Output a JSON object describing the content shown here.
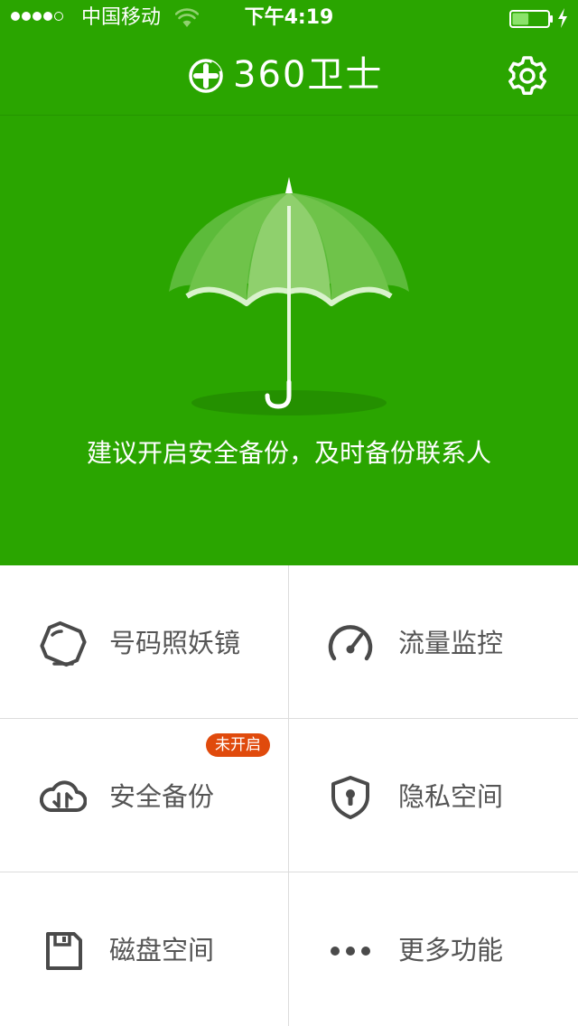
{
  "status_bar": {
    "carrier": "中国移动",
    "time": "下午4:19",
    "signal_strength": 4,
    "signal_total": 5,
    "battery_level": 0.45,
    "charging": true,
    "wifi": true
  },
  "header": {
    "brand_text": "360卫士",
    "settings_icon": "gear-icon"
  },
  "hero": {
    "illustration": "umbrella",
    "message": "建议开启安全备份，及时备份联系人"
  },
  "features": [
    {
      "label": "号码照妖镜",
      "icon": "magic-mirror-icon",
      "badge": ""
    },
    {
      "label": "流量监控",
      "icon": "speedometer-icon",
      "badge": ""
    },
    {
      "label": "安全备份",
      "icon": "cloud-sync-icon",
      "badge": "未开启"
    },
    {
      "label": "隐私空间",
      "icon": "shield-lock-icon",
      "badge": ""
    },
    {
      "label": "磁盘空间",
      "icon": "floppy-disk-icon",
      "badge": ""
    },
    {
      "label": "更多功能",
      "icon": "more-dots-icon",
      "badge": ""
    }
  ],
  "colors": {
    "brand_green": "#2aa500",
    "badge_orange": "#e04a0c",
    "icon_gray": "#4a4a4a",
    "label_gray": "#555555",
    "divider": "#dcdcdc"
  }
}
